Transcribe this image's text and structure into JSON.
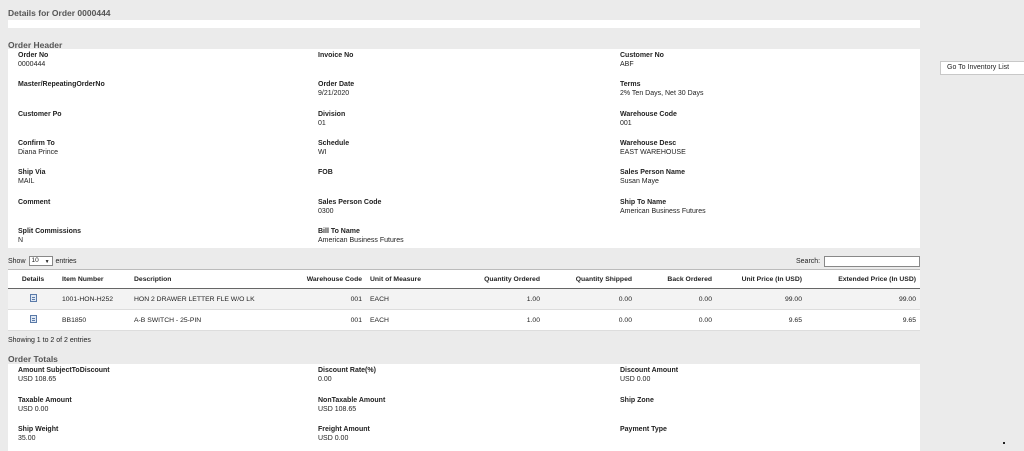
{
  "page": {
    "title": "Details for Order 0000444"
  },
  "side": {
    "inventory_button": "Go To Inventory List"
  },
  "header": {
    "title": "Order Header",
    "fields": [
      {
        "label": "Order No",
        "value": "0000444"
      },
      {
        "label": "Invoice No",
        "value": ""
      },
      {
        "label": "Customer No",
        "value": "ABF"
      },
      {
        "label": "Master/RepeatingOrderNo",
        "value": ""
      },
      {
        "label": "Order Date",
        "value": "9/21/2020"
      },
      {
        "label": "Terms",
        "value": "2% Ten Days, Net 30 Days"
      },
      {
        "label": "Customer Po",
        "value": ""
      },
      {
        "label": "Division",
        "value": "01"
      },
      {
        "label": "Warehouse Code",
        "value": "001"
      },
      {
        "label": "Confirm To",
        "value": "Diana Prince"
      },
      {
        "label": "Schedule",
        "value": "WI"
      },
      {
        "label": "Warehouse Desc",
        "value": "EAST WAREHOUSE"
      },
      {
        "label": "Ship Via",
        "value": "MAIL"
      },
      {
        "label": "FOB",
        "value": ""
      },
      {
        "label": "Sales Person Name",
        "value": "Susan Maye"
      },
      {
        "label": "Comment",
        "value": ""
      },
      {
        "label": "Sales Person Code",
        "value": "0300"
      },
      {
        "label": "Ship To Name",
        "value": "American Business Futures"
      },
      {
        "label": "Split Commissions",
        "value": "N"
      },
      {
        "label": "Bill To Name",
        "value": "American Business Futures"
      }
    ]
  },
  "table": {
    "show_label": "Show",
    "show_value": "10",
    "entries_label": "entries",
    "search_label": "Search:",
    "columns": [
      "Details",
      "Item Number",
      "Description",
      "Warehouse Code",
      "Unit of Measure",
      "Quantity Ordered",
      "Quantity Shipped",
      "Back Ordered",
      "Unit Price (In USD)",
      "Extended Price (In USD)"
    ],
    "rows": [
      {
        "item": "1001-HON-H252",
        "desc": "HON 2 DRAWER LETTER FLE W/O LK",
        "wh": "001",
        "uom": "EACH",
        "qty_ord": "1.00",
        "qty_ship": "0.00",
        "back": "0.00",
        "unit": "99.00",
        "ext": "99.00"
      },
      {
        "item": "BB1850",
        "desc": "A-B SWITCH - 25-PIN",
        "wh": "001",
        "uom": "EACH",
        "qty_ord": "1.00",
        "qty_ship": "0.00",
        "back": "0.00",
        "unit": "9.65",
        "ext": "9.65"
      }
    ],
    "info": "Showing 1 to 2 of 2 entries"
  },
  "totals": {
    "title": "Order Totals",
    "fields": [
      {
        "label": "Amount SubjectToDiscount",
        "value": "USD 108.65"
      },
      {
        "label": "Discount Rate(%)",
        "value": "0.00"
      },
      {
        "label": "Discount Amount",
        "value": "USD 0.00"
      },
      {
        "label": "Taxable Amount",
        "value": "USD 0.00"
      },
      {
        "label": "NonTaxable Amount",
        "value": "USD 108.65"
      },
      {
        "label": "Ship Zone",
        "value": ""
      },
      {
        "label": "Ship Weight",
        "value": "35.00"
      },
      {
        "label": "Freight Amount",
        "value": "USD 0.00"
      },
      {
        "label": "Payment Type",
        "value": ""
      }
    ]
  }
}
